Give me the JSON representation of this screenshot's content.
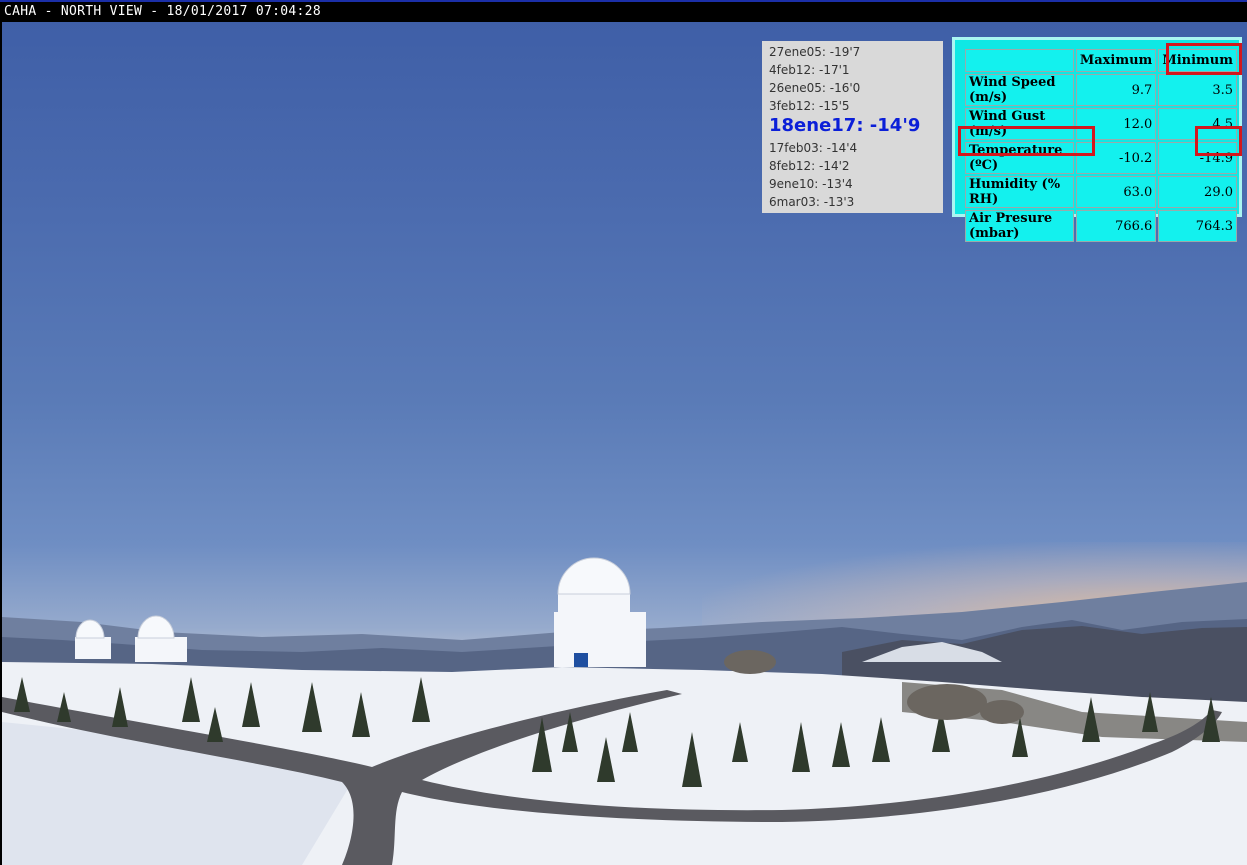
{
  "camera": {
    "title": "CAHA - NORTH VIEW - 18/01/2017 07:04:28"
  },
  "records": {
    "entries": [
      "27ene05: -19'7",
      "4feb12: -17'1",
      "26ene05: -16'0",
      "3feb12: -15'5",
      "18ene17: -14'9",
      "17feb03: -14'4",
      "8feb12: -14'2",
      "9ene10: -13'4",
      "6mar03: -13'3"
    ],
    "highlight_color": "#0b1fd8"
  },
  "weather": {
    "columns": [
      "",
      "Maximum",
      "Minimum"
    ],
    "rows": [
      {
        "label": "Wind Speed (m/s)",
        "max": "9.7",
        "min": "3.5"
      },
      {
        "label": "Wind Gust (m/s)",
        "max": "12.0",
        "min": "4.5"
      },
      {
        "label": "Temperature (ºC)",
        "max": "-10.2",
        "min": "-14.9"
      },
      {
        "label": "Humidity (% RH)",
        "max": "63.0",
        "min": "29.0"
      },
      {
        "label": "Air Presure (mbar)",
        "max": "766.6",
        "min": "764.3"
      }
    ],
    "panel_color": "#13f1ee",
    "highlight_color": "#d3171d"
  }
}
